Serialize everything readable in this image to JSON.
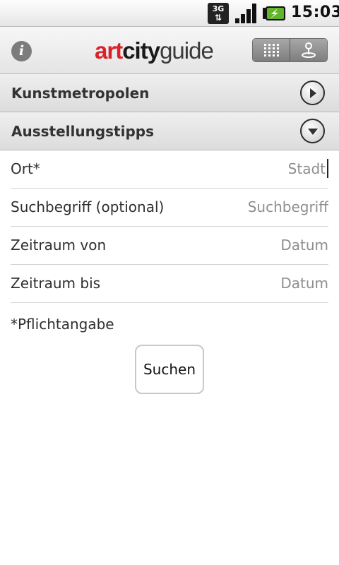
{
  "status_bar": {
    "network": "3G",
    "time": "15:03",
    "icons": [
      "network-3g-icon",
      "signal-strength-icon",
      "battery-charging-icon"
    ]
  },
  "header": {
    "info_icon": "info-icon",
    "logo": {
      "part1": "art",
      "part2": "city",
      "part3": "guide"
    },
    "logo_colors": {
      "art": "#d8232a",
      "city": "#1a1a1a",
      "guide": "#3a3a3a"
    },
    "view_toggle": [
      "grid-view-icon",
      "map-location-icon"
    ]
  },
  "sections": [
    {
      "title": "Kunstmetropolen",
      "state": "collapsed",
      "icon": "chevron-right-circle-icon"
    },
    {
      "title": "Ausstellungstipps",
      "state": "expanded",
      "icon": "chevron-down-circle-icon"
    }
  ],
  "form": {
    "fields": [
      {
        "label": "Ort*",
        "value": "",
        "placeholder": "Stadt"
      },
      {
        "label": "Suchbegriff (optional)",
        "value": "",
        "placeholder": "Suchbegriff"
      },
      {
        "label": "Zeitraum von",
        "value": "",
        "placeholder": "Datum"
      },
      {
        "label": "Zeitraum bis",
        "value": "",
        "placeholder": "Datum"
      }
    ],
    "required_note": "*Pflichtangabe",
    "submit_label": "Suchen"
  }
}
